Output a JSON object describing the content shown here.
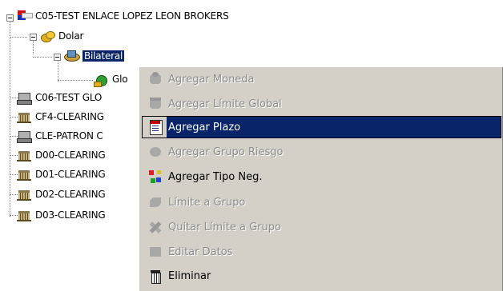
{
  "tree": {
    "nodes": [
      {
        "id": "c05",
        "label": "C05-TEST ENLACE LOPEZ LEON BROKERS",
        "icon": "flag-icon"
      },
      {
        "id": "dolar",
        "label": "Dolar",
        "icon": "coins-icon"
      },
      {
        "id": "bilateral",
        "label": "Bilateral",
        "icon": "money-icon",
        "selected": true
      },
      {
        "id": "glo",
        "label": "Glo",
        "icon": "money-bag-icon"
      },
      {
        "id": "c06",
        "label": "C06-TEST GLO",
        "icon": "computer-icon"
      },
      {
        "id": "cf4",
        "label": "CF4-CLEARING",
        "icon": "bank-icon"
      },
      {
        "id": "cle",
        "label": "CLE-PATRON C",
        "icon": "computer-icon"
      },
      {
        "id": "d00",
        "label": "D00-CLEARING",
        "icon": "bank-icon"
      },
      {
        "id": "d01",
        "label": "D01-CLEARING",
        "icon": "bank-icon"
      },
      {
        "id": "d02",
        "label": "D02-CLEARING",
        "icon": "bank-icon"
      },
      {
        "id": "d03",
        "label": "D03-CLEARING",
        "icon": "bank-icon"
      }
    ]
  },
  "menu": {
    "items": [
      {
        "label": "Agregar Moneda",
        "enabled": false,
        "icon": "coin-stack-icon"
      },
      {
        "label": "Agregar Límite Global",
        "enabled": false,
        "icon": "bank-icon"
      },
      {
        "label": "Agregar Plazo",
        "enabled": true,
        "highlighted": true,
        "icon": "calendar-icon"
      },
      {
        "label": "Agregar Grupo Riesgo",
        "enabled": false,
        "icon": "risk-group-icon"
      },
      {
        "label": "Agregar Tipo Neg.",
        "enabled": true,
        "icon": "network-icon"
      },
      {
        "label": "Límite a Grupo",
        "enabled": false,
        "icon": "arrow-icon"
      },
      {
        "label": "Quitar Límite a Grupo",
        "enabled": false,
        "icon": "remove-icon"
      },
      {
        "label": "Editar Datos",
        "enabled": false,
        "icon": "edit-icon"
      },
      {
        "label": "Eliminar",
        "enabled": true,
        "icon": "trash-icon"
      }
    ]
  },
  "colors": {
    "selection": "#0a246a",
    "menu_bg": "#d4d0c8",
    "disabled_text": "#8c8c8c"
  }
}
